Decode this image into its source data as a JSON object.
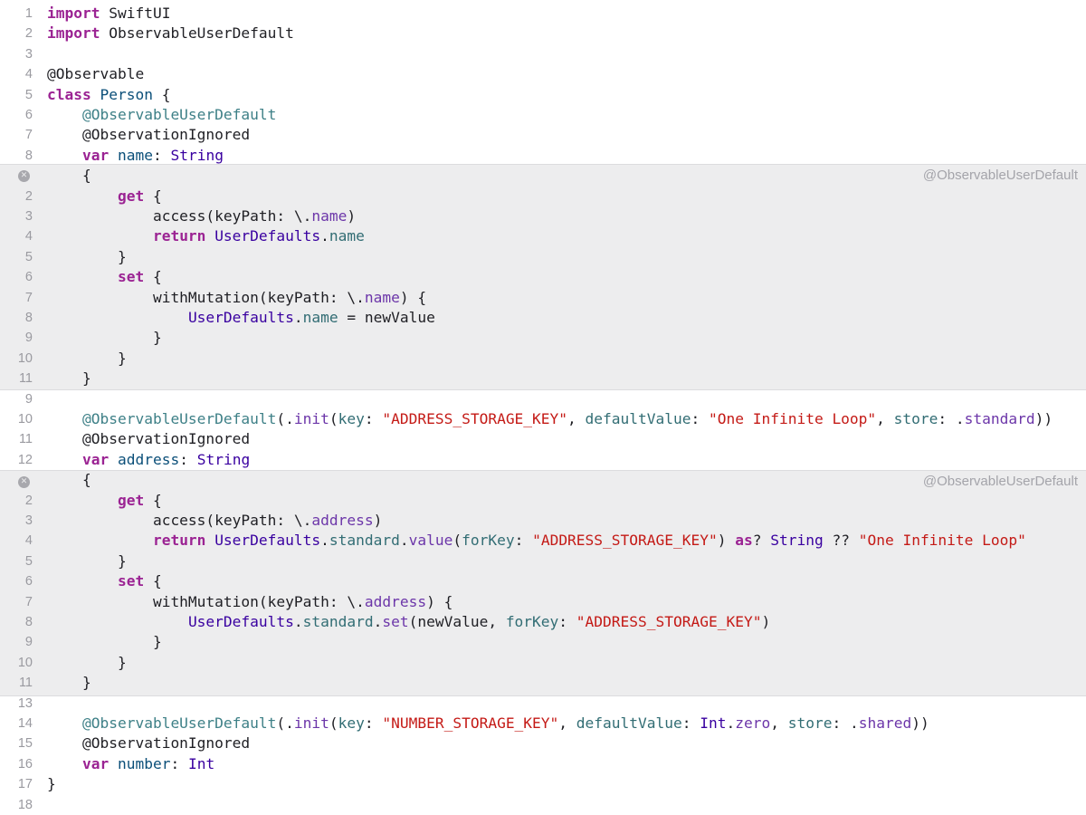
{
  "expansions": [
    {
      "title": "@ObservableUserDefault"
    },
    {
      "title": "@ObservableUserDefault"
    }
  ],
  "lines": [
    {
      "n": "1",
      "t": [
        [
          "kw",
          "import"
        ],
        [
          "pl",
          " SwiftUI"
        ]
      ]
    },
    {
      "n": "2",
      "t": [
        [
          "kw",
          "import"
        ],
        [
          "pl",
          " ObservableUserDefault"
        ]
      ]
    },
    {
      "n": "3",
      "t": []
    },
    {
      "n": "4",
      "t": [
        [
          "pl",
          "@Observable"
        ]
      ]
    },
    {
      "n": "5",
      "t": [
        [
          "kw",
          "class"
        ],
        [
          "pl",
          " "
        ],
        [
          "tyd",
          "Person"
        ],
        [
          "pl",
          " {"
        ]
      ]
    },
    {
      "n": "6",
      "t": [
        [
          "pl",
          "    "
        ],
        [
          "attr",
          "@ObservableUserDefault"
        ]
      ]
    },
    {
      "n": "7",
      "t": [
        [
          "pl",
          "    @ObservationIgnored"
        ]
      ]
    },
    {
      "n": "8",
      "t": [
        [
          "pl",
          "    "
        ],
        [
          "kw",
          "var"
        ],
        [
          "pl",
          " "
        ],
        [
          "tyd",
          "name"
        ],
        [
          "pl",
          ": "
        ],
        [
          "ty",
          "String"
        ]
      ]
    },
    {
      "n": "",
      "t": [
        [
          "pl",
          "    {"
        ]
      ]
    },
    {
      "n": "2",
      "t": [
        [
          "pl",
          "        "
        ],
        [
          "kw",
          "get"
        ],
        [
          "pl",
          " {"
        ]
      ]
    },
    {
      "n": "3",
      "t": [
        [
          "pl",
          "            access(keyPath: \\."
        ],
        [
          "id",
          "name"
        ],
        [
          "pl",
          ")"
        ]
      ]
    },
    {
      "n": "4",
      "t": [
        [
          "pl",
          "            "
        ],
        [
          "kw",
          "return"
        ],
        [
          "pl",
          " "
        ],
        [
          "ty",
          "UserDefaults"
        ],
        [
          "pl",
          "."
        ],
        [
          "prop",
          "name"
        ]
      ]
    },
    {
      "n": "5",
      "t": [
        [
          "pl",
          "        }"
        ]
      ]
    },
    {
      "n": "6",
      "t": [
        [
          "pl",
          "        "
        ],
        [
          "kw",
          "set"
        ],
        [
          "pl",
          " {"
        ]
      ]
    },
    {
      "n": "7",
      "t": [
        [
          "pl",
          "            withMutation(keyPath: \\."
        ],
        [
          "id",
          "name"
        ],
        [
          "pl",
          ") {"
        ]
      ]
    },
    {
      "n": "8",
      "t": [
        [
          "pl",
          "                "
        ],
        [
          "ty",
          "UserDefaults"
        ],
        [
          "pl",
          "."
        ],
        [
          "prop",
          "name"
        ],
        [
          "pl",
          " = newValue"
        ]
      ]
    },
    {
      "n": "9",
      "t": [
        [
          "pl",
          "            }"
        ]
      ]
    },
    {
      "n": "10",
      "t": [
        [
          "pl",
          "        }"
        ]
      ]
    },
    {
      "n": "11",
      "t": [
        [
          "pl",
          "    }"
        ]
      ]
    },
    {
      "n": "9",
      "t": []
    },
    {
      "n": "10",
      "t": [
        [
          "pl",
          "    "
        ],
        [
          "attr",
          "@ObservableUserDefault"
        ],
        [
          "pl",
          "(."
        ],
        [
          "id",
          "init"
        ],
        [
          "pl",
          "("
        ],
        [
          "prop",
          "key"
        ],
        [
          "pl",
          ": "
        ],
        [
          "str",
          "\"ADDRESS_STORAGE_KEY\""
        ],
        [
          "pl",
          ", "
        ],
        [
          "prop",
          "defaultValue"
        ],
        [
          "pl",
          ": "
        ],
        [
          "str",
          "\"One Infinite Loop\""
        ],
        [
          "pl",
          ", "
        ],
        [
          "prop",
          "store"
        ],
        [
          "pl",
          ": ."
        ],
        [
          "id",
          "standard"
        ],
        [
          "pl",
          "))"
        ]
      ]
    },
    {
      "n": "11",
      "t": [
        [
          "pl",
          "    @ObservationIgnored"
        ]
      ]
    },
    {
      "n": "12",
      "t": [
        [
          "pl",
          "    "
        ],
        [
          "kw",
          "var"
        ],
        [
          "pl",
          " "
        ],
        [
          "tyd",
          "address"
        ],
        [
          "pl",
          ": "
        ],
        [
          "ty",
          "String"
        ]
      ]
    },
    {
      "n": "",
      "t": [
        [
          "pl",
          "    {"
        ]
      ]
    },
    {
      "n": "2",
      "t": [
        [
          "pl",
          "        "
        ],
        [
          "kw",
          "get"
        ],
        [
          "pl",
          " {"
        ]
      ]
    },
    {
      "n": "3",
      "t": [
        [
          "pl",
          "            access(keyPath: \\."
        ],
        [
          "id",
          "address"
        ],
        [
          "pl",
          ")"
        ]
      ]
    },
    {
      "n": "4",
      "t": [
        [
          "pl",
          "            "
        ],
        [
          "kw",
          "return"
        ],
        [
          "pl",
          " "
        ],
        [
          "ty",
          "UserDefaults"
        ],
        [
          "pl",
          "."
        ],
        [
          "prop",
          "standard"
        ],
        [
          "pl",
          "."
        ],
        [
          "id",
          "value"
        ],
        [
          "pl",
          "("
        ],
        [
          "prop",
          "forKey"
        ],
        [
          "pl",
          ": "
        ],
        [
          "str",
          "\"ADDRESS_STORAGE_KEY\""
        ],
        [
          "pl",
          ") "
        ],
        [
          "kw",
          "as"
        ],
        [
          "pl",
          "? "
        ],
        [
          "ty",
          "String"
        ],
        [
          "pl",
          " ?? "
        ],
        [
          "str",
          "\"One Infinite Loop\""
        ]
      ]
    },
    {
      "n": "5",
      "t": [
        [
          "pl",
          "        }"
        ]
      ]
    },
    {
      "n": "6",
      "t": [
        [
          "pl",
          "        "
        ],
        [
          "kw",
          "set"
        ],
        [
          "pl",
          " {"
        ]
      ]
    },
    {
      "n": "7",
      "t": [
        [
          "pl",
          "            withMutation(keyPath: \\."
        ],
        [
          "id",
          "address"
        ],
        [
          "pl",
          ") {"
        ]
      ]
    },
    {
      "n": "8",
      "t": [
        [
          "pl",
          "                "
        ],
        [
          "ty",
          "UserDefaults"
        ],
        [
          "pl",
          "."
        ],
        [
          "prop",
          "standard"
        ],
        [
          "pl",
          "."
        ],
        [
          "id",
          "set"
        ],
        [
          "pl",
          "(newValue, "
        ],
        [
          "prop",
          "forKey"
        ],
        [
          "pl",
          ": "
        ],
        [
          "str",
          "\"ADDRESS_STORAGE_KEY\""
        ],
        [
          "pl",
          ")"
        ]
      ]
    },
    {
      "n": "9",
      "t": [
        [
          "pl",
          "            }"
        ]
      ]
    },
    {
      "n": "10",
      "t": [
        [
          "pl",
          "        }"
        ]
      ]
    },
    {
      "n": "11",
      "t": [
        [
          "pl",
          "    }"
        ]
      ]
    },
    {
      "n": "13",
      "t": []
    },
    {
      "n": "14",
      "t": [
        [
          "pl",
          "    "
        ],
        [
          "attr",
          "@ObservableUserDefault"
        ],
        [
          "pl",
          "(."
        ],
        [
          "id",
          "init"
        ],
        [
          "pl",
          "("
        ],
        [
          "prop",
          "key"
        ],
        [
          "pl",
          ": "
        ],
        [
          "str",
          "\"NUMBER_STORAGE_KEY\""
        ],
        [
          "pl",
          ", "
        ],
        [
          "prop",
          "defaultValue"
        ],
        [
          "pl",
          ": "
        ],
        [
          "ty",
          "Int"
        ],
        [
          "pl",
          "."
        ],
        [
          "id",
          "zero"
        ],
        [
          "pl",
          ", "
        ],
        [
          "prop",
          "store"
        ],
        [
          "pl",
          ": ."
        ],
        [
          "id",
          "shared"
        ],
        [
          "pl",
          "))"
        ]
      ]
    },
    {
      "n": "15",
      "t": [
        [
          "pl",
          "    @ObservationIgnored"
        ]
      ]
    },
    {
      "n": "16",
      "t": [
        [
          "pl",
          "    "
        ],
        [
          "kw",
          "var"
        ],
        [
          "pl",
          " "
        ],
        [
          "tyd",
          "number"
        ],
        [
          "pl",
          ": "
        ],
        [
          "ty",
          "Int"
        ]
      ]
    },
    {
      "n": "17",
      "t": [
        [
          "pl",
          "}"
        ]
      ]
    },
    {
      "n": "18",
      "t": []
    }
  ]
}
